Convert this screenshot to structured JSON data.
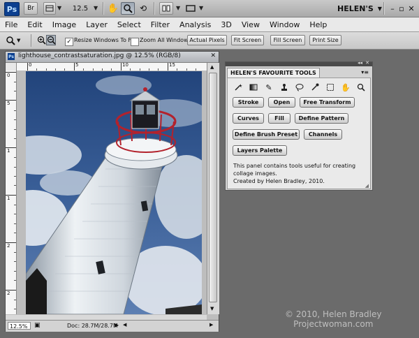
{
  "appbar": {
    "ps_logo": "Ps",
    "br_label": "Br",
    "zoom_value": "12.5",
    "workspace": "HELEN'S"
  },
  "menu": [
    "File",
    "Edit",
    "Image",
    "Layer",
    "Select",
    "Filter",
    "Analysis",
    "3D",
    "View",
    "Window",
    "Help"
  ],
  "options": {
    "resize_label": "Resize Windows To Fit",
    "resize_checked": "✓",
    "zoom_all_label": "Zoom All Windows",
    "actual_pixels": "Actual Pixels",
    "fit_screen": "Fit Screen",
    "fill_screen": "Fill Screen",
    "print_size": "Print Size"
  },
  "document": {
    "title": "lighthouse_contrastsaturation.jpg @ 12.5% (RGB/8)",
    "zoom": "12.5%",
    "doc_info": "Doc: 28.7M/28.7M",
    "ruler_top": [
      "0",
      "5",
      "10",
      "15"
    ],
    "ruler_left": [
      "0",
      "5",
      "1",
      "1",
      "2",
      "2"
    ]
  },
  "panel": {
    "title": "HELEN'S FAVOURITE TOOLS",
    "buttons": {
      "stroke": "Stroke",
      "open": "Open",
      "free_transform": "Free Transform",
      "curves": "Curves",
      "fill": "Fill",
      "define_pattern": "Define Pattern",
      "define_brush_preset": "Define Brush Preset",
      "channels": "Channels",
      "layers_palette": "Layers Palette"
    },
    "description_1": "This panel contains tools useful for creating collage images.",
    "description_2": "Created by Helen Bradley, 2010."
  },
  "watermark": {
    "line1": "© 2010, Helen Bradley",
    "line2": "Projectwoman.com"
  },
  "icons": [
    "wand-icon",
    "gradient-icon",
    "brush-icon",
    "stamp-icon",
    "lasso-icon",
    "eyedropper-icon",
    "marquee-icon",
    "hand-icon",
    "zoom-icon"
  ],
  "colors": {
    "ps_blue": "#0c3f8f",
    "sky": "#2c4e86",
    "lighthouse": "#e9eef2",
    "lantern_red": "#b3222c"
  }
}
